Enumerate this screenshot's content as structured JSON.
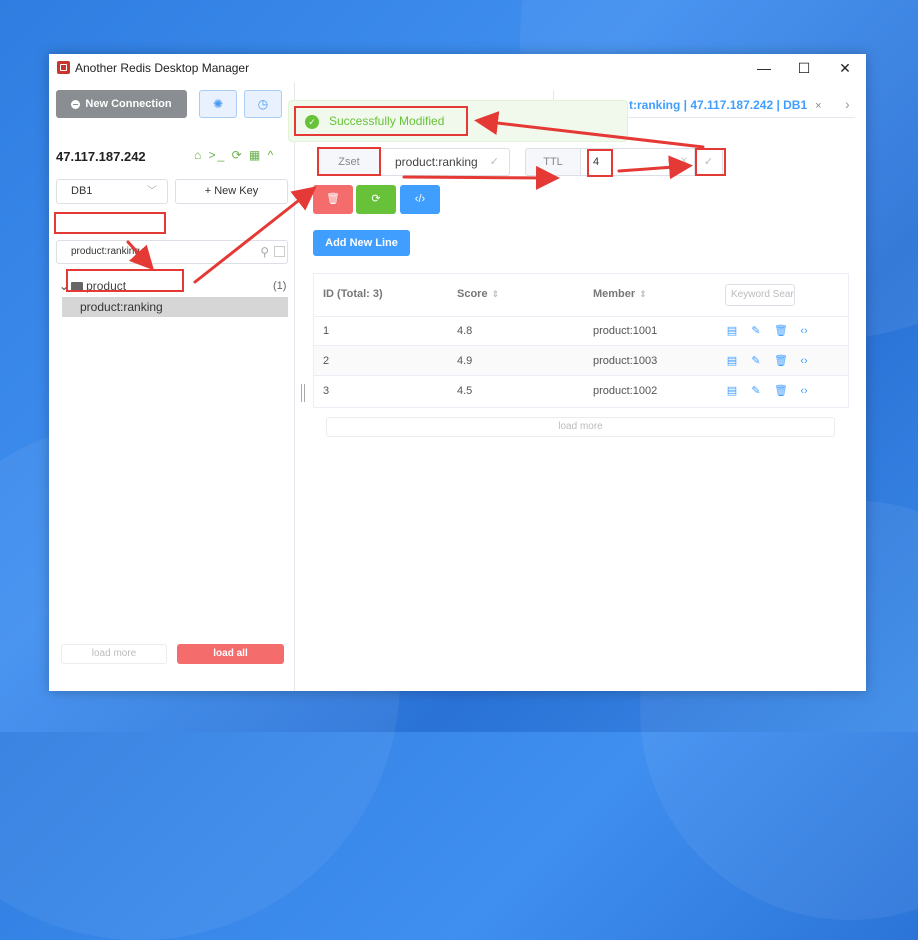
{
  "window": {
    "title": "Another Redis Desktop Manager",
    "minimize": "—",
    "maximize": "☐",
    "close": "✕"
  },
  "sidebar": {
    "new_connection": "New Connection",
    "connection_name": "47.117.187.242",
    "conn_icons": "⌂ >_ ⟳ ▦ ^",
    "db_select": "DB1",
    "new_key": "+ New Key",
    "search_value": "product:ranking",
    "tree_folder": "product",
    "tree_count": "(1)",
    "tree_item": "product:ranking",
    "load_more": "load more",
    "load_all": "load all"
  },
  "tab": {
    "label": "t:ranking | 47.117.187.242 | DB1",
    "close": "×"
  },
  "toast": {
    "message": "Successfully Modified"
  },
  "key_panel": {
    "type": "Zset",
    "key_name": "product:ranking",
    "ttl_label": "TTL",
    "ttl_value": "4",
    "add_new_line": "Add New Line"
  },
  "table": {
    "headers": {
      "id": "ID (Total: 3)",
      "score": "Score",
      "member": "Member"
    },
    "keyword_placeholder": "Keyword Search",
    "rows": [
      {
        "id": "1",
        "score": "4.8",
        "member": "product:1001"
      },
      {
        "id": "2",
        "score": "4.9",
        "member": "product:1003"
      },
      {
        "id": "3",
        "score": "4.5",
        "member": "product:1002"
      }
    ],
    "load_more": "load more"
  },
  "colors": {
    "primary": "#409eff",
    "danger": "#f56c6c",
    "success": "#67c23a",
    "annotation": "#e53935"
  }
}
